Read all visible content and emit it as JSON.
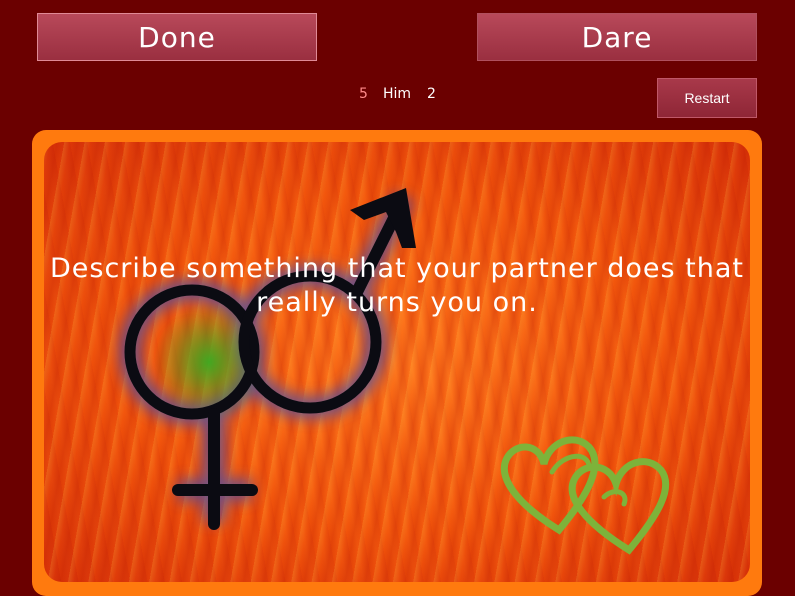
{
  "buttons": {
    "done_label": "Done",
    "dare_label": "Dare",
    "restart_label": "Restart"
  },
  "score": {
    "left": "5",
    "player": "Him",
    "right": "2"
  },
  "card": {
    "prompt": "Describe something that your partner does that really turns you on.",
    "icons": [
      "gender-symbols-icon",
      "hearts-icon"
    ]
  },
  "colors": {
    "background": "#6b0000",
    "button": "#a8394a",
    "card_border": "#ff7a0e",
    "hearts": "#7db33a"
  }
}
